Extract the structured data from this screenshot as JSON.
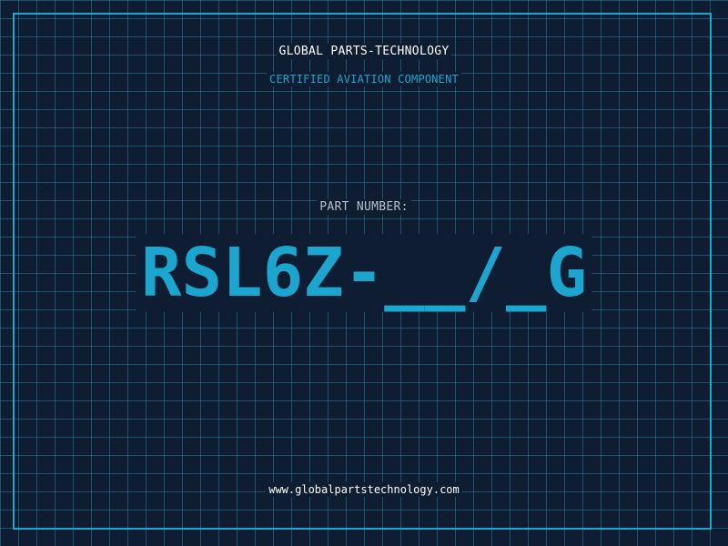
{
  "header": {
    "company": "GLOBAL PARTS-TECHNOLOGY",
    "subtitle": "CERTIFIED AVIATION COMPONENT"
  },
  "part": {
    "label": "PART NUMBER:",
    "number": "RSL6Z-__/_G"
  },
  "footer": {
    "website": "www.globalpartstechnology.com"
  },
  "colors": {
    "background": "#0f1d33",
    "grid": "#2a7d9b",
    "accent": "#1aa6cf",
    "text": "#ffffff",
    "label": "#b6c0cc"
  }
}
